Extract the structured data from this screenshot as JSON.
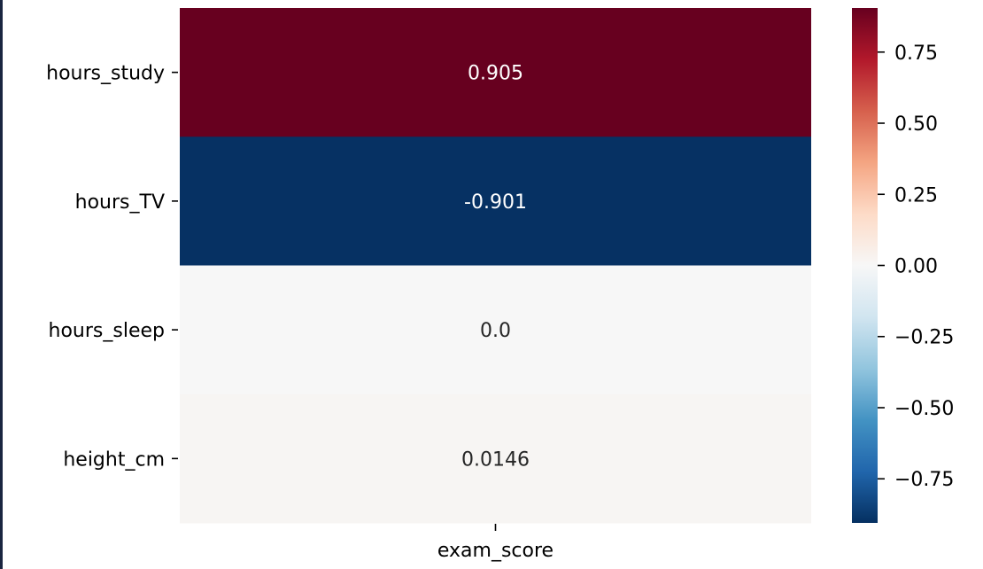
{
  "chart_data": {
    "type": "heatmap",
    "title": "",
    "xlabel": "",
    "ylabel": "",
    "columns": [
      "exam_score"
    ],
    "rows": [
      "hours_study",
      "hours_TV",
      "hours_sleep",
      "height_cm"
    ],
    "values": [
      [
        0.905
      ],
      [
        -0.901
      ],
      [
        0.0
      ],
      [
        0.0146
      ]
    ],
    "annotations": [
      [
        "0.905"
      ],
      [
        "-0.901"
      ],
      [
        "0.0"
      ],
      [
        "0.0146"
      ]
    ],
    "colormap": "RdBu_r",
    "vmin": -0.905,
    "vmax": 0.905,
    "colorbar": {
      "ticks": [
        0.75,
        0.5,
        0.25,
        0.0,
        -0.25,
        -0.5,
        -0.75
      ],
      "tick_labels": [
        "0.75",
        "0.50",
        "0.25",
        "0.00",
        "−0.25",
        "−0.50",
        "−0.75"
      ]
    }
  }
}
